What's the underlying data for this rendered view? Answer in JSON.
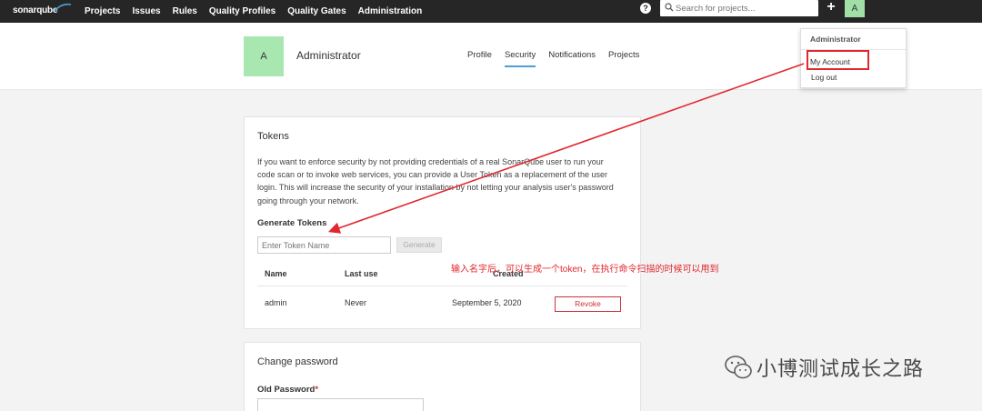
{
  "topnav": {
    "logo": "sonarqube",
    "items": [
      "Projects",
      "Issues",
      "Rules",
      "Quality Profiles",
      "Quality Gates",
      "Administration"
    ],
    "help_icon": "?",
    "search_placeholder": "Search for projects...",
    "plus_icon": "+",
    "avatar_letter": "A"
  },
  "header": {
    "avatar_letter": "A",
    "name": "Administrator",
    "tabs": [
      "Profile",
      "Security",
      "Notifications",
      "Projects"
    ],
    "active_tab": "Security"
  },
  "dropdown": {
    "title": "Administrator",
    "my_account": "My Account",
    "logout": "Log out"
  },
  "tokens": {
    "title": "Tokens",
    "description": "If you want to enforce security by not providing credentials of a real SonarQube user to run your code scan or to invoke web services, you can provide a User Token as a replacement of the user login. This will increase the security of your installation by not letting your analysis user's password going through your network.",
    "generate_title": "Generate Tokens",
    "input_placeholder": "Enter Token Name",
    "generate_button": "Generate",
    "columns": [
      "Name",
      "Last use",
      "Created"
    ],
    "rows": [
      {
        "name": "admin",
        "last_use": "Never",
        "created": "September 5, 2020",
        "action": "Revoke"
      }
    ]
  },
  "password": {
    "title": "Change password",
    "old_password_label": "Old Password",
    "required_mark": "*"
  },
  "annotation": {
    "text": "输入名字后，可以生成一个token，在执行命令扫描的时候可以用到",
    "color": "#e0282e"
  },
  "watermark": {
    "text": "小博测试成长之路"
  },
  "colors": {
    "nav_bg": "#262626",
    "accent": "#4b9fd5",
    "avatar": "#a8e8b0",
    "danger": "#d02f3a"
  }
}
